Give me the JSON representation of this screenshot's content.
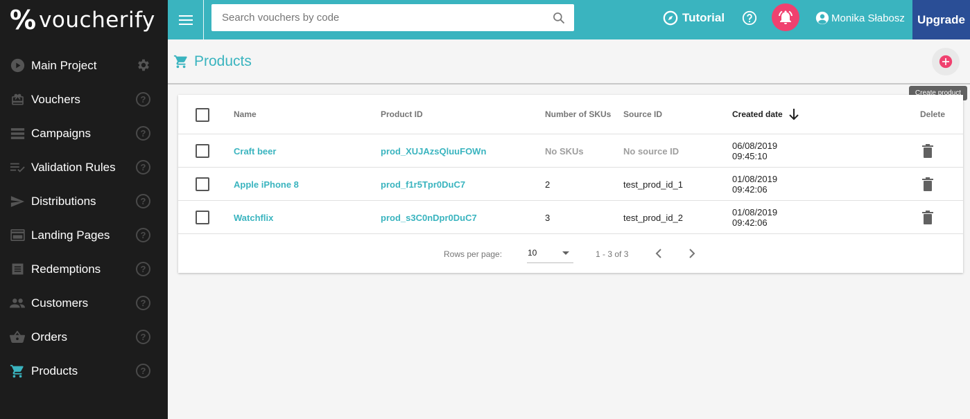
{
  "app": {
    "logo_mark": "%",
    "logo_text": "voucherify"
  },
  "sidebar": {
    "items": [
      {
        "label": "Main Project",
        "icon": "play-circle-icon",
        "action": "gear"
      },
      {
        "label": "Vouchers",
        "icon": "voucher-icon",
        "action": "help"
      },
      {
        "label": "Campaigns",
        "icon": "campaigns-icon",
        "action": "help"
      },
      {
        "label": "Validation Rules",
        "icon": "rules-icon",
        "action": "help"
      },
      {
        "label": "Distributions",
        "icon": "send-icon",
        "action": "help"
      },
      {
        "label": "Landing Pages",
        "icon": "landing-icon",
        "action": "help"
      },
      {
        "label": "Redemptions",
        "icon": "redemptions-icon",
        "action": "help"
      },
      {
        "label": "Customers",
        "icon": "customers-icon",
        "action": "help"
      },
      {
        "label": "Orders",
        "icon": "basket-icon",
        "action": "help"
      },
      {
        "label": "Products",
        "icon": "cart-icon",
        "action": "help",
        "active": true
      }
    ],
    "help_glyph": "?"
  },
  "topbar": {
    "search_placeholder": "Search vouchers by code",
    "tutorial_label": "Tutorial",
    "user_name": "Monika Słabosz",
    "upgrade_label": "Upgrade"
  },
  "page": {
    "title": "Products",
    "create_tooltip": "Create product"
  },
  "table": {
    "columns": {
      "name": "Name",
      "product_id": "Product ID",
      "skus": "Number of SKUs",
      "source_id": "Source ID",
      "created": "Created date",
      "delete": "Delete"
    },
    "rows": [
      {
        "name": "Craft beer",
        "product_id": "prod_XUJAzsQluuFOWn",
        "skus": "No SKUs",
        "source_id": "No source ID",
        "date": "06/08/2019",
        "time": "09:45:10"
      },
      {
        "name": "Apple iPhone 8",
        "product_id": "prod_f1r5Tpr0DuC7",
        "skus": "2",
        "source_id": "test_prod_id_1",
        "date": "01/08/2019",
        "time": "09:42:06"
      },
      {
        "name": "Watchflix",
        "product_id": "prod_s3C0nDpr0DuC7",
        "skus": "3",
        "source_id": "test_prod_id_2",
        "date": "01/08/2019",
        "time": "09:42:06"
      }
    ],
    "pager": {
      "rows_per_page_label": "Rows per page:",
      "rows_per_page": "10",
      "range": "1 - 3 of 3"
    }
  },
  "colors": {
    "accent": "#3ab4bf",
    "sidebar_bg": "#1c1c1c",
    "upgrade_bg": "#2a4e96",
    "bell_bg": "#f0416f"
  }
}
